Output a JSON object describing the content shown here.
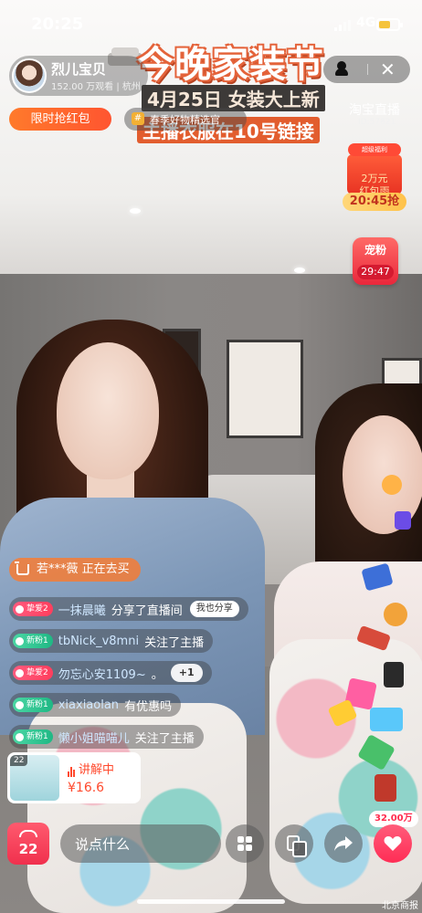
{
  "status_bar": {
    "time": "20:25",
    "network": "4G",
    "battery_level": 0.6,
    "battery_color": "#f5c33b"
  },
  "host": {
    "name": "烈儿宝贝",
    "stats": "152.00 万观看 | 杭州"
  },
  "banner": {
    "title": "今晚家装节",
    "line2": "4月25日  女装大上新",
    "line3": "主播衣服在10号链接"
  },
  "brand": {
    "name": "淘宝直播",
    "id": "ID:57821"
  },
  "red_packet_button": {
    "label": "限时抢红包"
  },
  "tag_chip": {
    "icon": "#",
    "label": "春季好物精选官"
  },
  "red_rain": {
    "badge": "超级福利",
    "line1": "2万元",
    "line2": "红包雨",
    "time": "20:45抢"
  },
  "fans_card": {
    "label": "宠粉",
    "time": "29:47"
  },
  "buying_notice": {
    "text": "若***薇 正在去买"
  },
  "comments": [
    {
      "badge_type": "love",
      "badge": "挚爱2",
      "nick": "一抹晨曦",
      "action": "分享了直播间",
      "extra": "我也分享"
    },
    {
      "badge_type": "fan",
      "badge": "新粉1",
      "nick": "tbNick_v8mni",
      "action": "关注了主播",
      "extra": ""
    },
    {
      "badge_type": "love",
      "badge": "挚爱2",
      "nick": "勿忘心安1109~",
      "action": "。",
      "extra": "+1"
    },
    {
      "badge_type": "fan",
      "badge": "新粉1",
      "nick": "xiaxiaolan",
      "action": "有优惠吗",
      "extra": ""
    },
    {
      "badge_type": "fan",
      "badge": "新粉1",
      "nick": "懒小姐喵喵儿",
      "action": "关注了主播",
      "extra": ""
    }
  ],
  "product_card": {
    "number": "22",
    "status": "讲解中",
    "price": "¥16.6"
  },
  "like_price_bubble": "32.00万",
  "bottom_bar": {
    "cart_count": "22",
    "input_placeholder": "说点什么"
  },
  "watermark": "北京商报",
  "colors": {
    "accent_red": "#ff2d55",
    "accent_orange": "#ff5a2e",
    "fan_green": "#1fb884"
  },
  "icons": [
    "cart-icon",
    "grid-icon",
    "copy-icon",
    "share-icon",
    "heart-icon",
    "close-icon",
    "person-icon"
  ]
}
